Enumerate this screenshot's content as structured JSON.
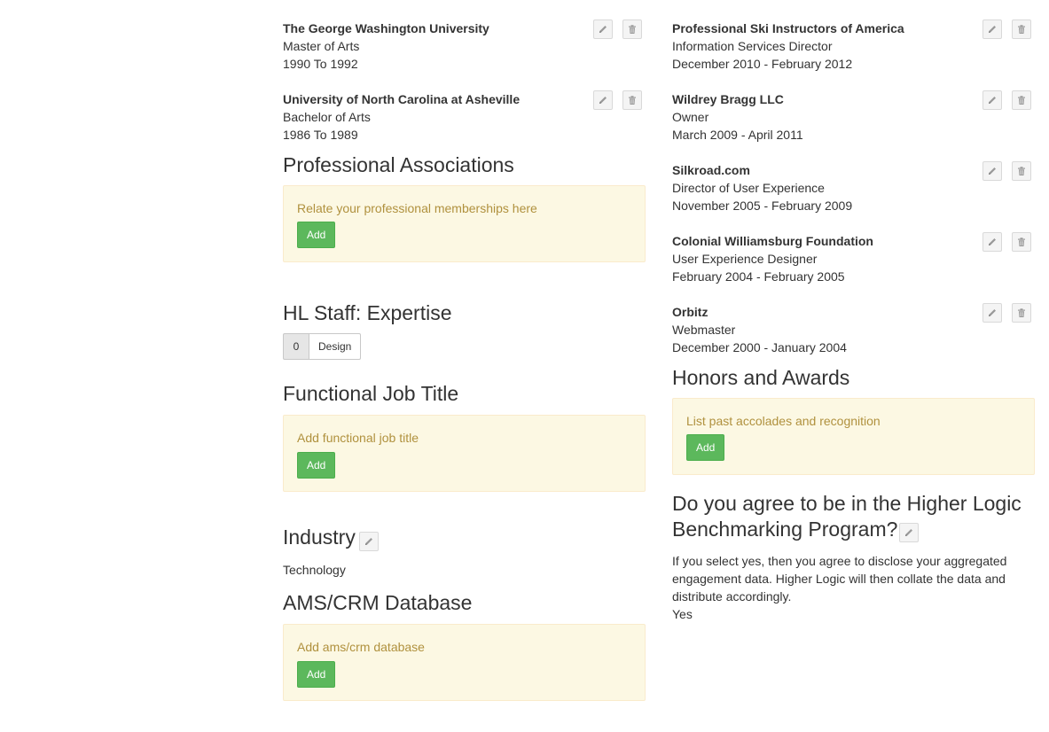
{
  "education": [
    {
      "school": "The George Washington University",
      "degree": "Master of Arts",
      "years": "1990 To 1992"
    },
    {
      "school": "University of North Carolina at Asheville",
      "degree": "Bachelor of Arts",
      "years": "1986 To 1989"
    }
  ],
  "professional_associations": {
    "heading": "Professional Associations",
    "message": "Relate your professional memberships here",
    "button": "Add"
  },
  "expertise": {
    "heading": "HL Staff: Expertise",
    "tags": [
      {
        "count": "0",
        "label": "Design"
      }
    ]
  },
  "functional_job_title": {
    "heading": "Functional Job Title",
    "message": "Add functional job title",
    "button": "Add"
  },
  "industry": {
    "heading": "Industry",
    "value": "Technology"
  },
  "ams_crm": {
    "heading": "AMS/CRM Database",
    "message": "Add ams/crm database",
    "button": "Add"
  },
  "experience": [
    {
      "company": "Professional Ski Instructors of America",
      "title": "Information Services Director",
      "dates": "December 2010 - February 2012"
    },
    {
      "company": "Wildrey Bragg LLC",
      "title": "Owner",
      "dates": "March 2009 - April 2011"
    },
    {
      "company": "Silkroad.com",
      "title": "Director of User Experience",
      "dates": "November 2005 - February 2009"
    },
    {
      "company": "Colonial Williamsburg Foundation",
      "title": "User Experience Designer",
      "dates": "February 2004 - February 2005"
    },
    {
      "company": "Orbitz",
      "title": "Webmaster",
      "dates": "December 2000 - January 2004"
    }
  ],
  "honors": {
    "heading": "Honors and Awards",
    "message": "List past accolades and recognition",
    "button": "Add"
  },
  "benchmarking": {
    "heading_line1": "Do you agree to be in the Higher Logic",
    "heading_line2": "Benchmarking Program?",
    "description_line1": "If you select yes, then you agree to disclose your aggregated",
    "description_line2": "engagement data. Higher Logic will then collate the data and",
    "description_line3": "distribute accordingly.",
    "answer": "Yes"
  },
  "icons": {
    "edit": "pencil-icon",
    "delete": "trash-icon"
  },
  "colors": {
    "add_button": "#5cb85c",
    "alert_background": "#fcf8e3",
    "alert_text": "#b0913e"
  }
}
